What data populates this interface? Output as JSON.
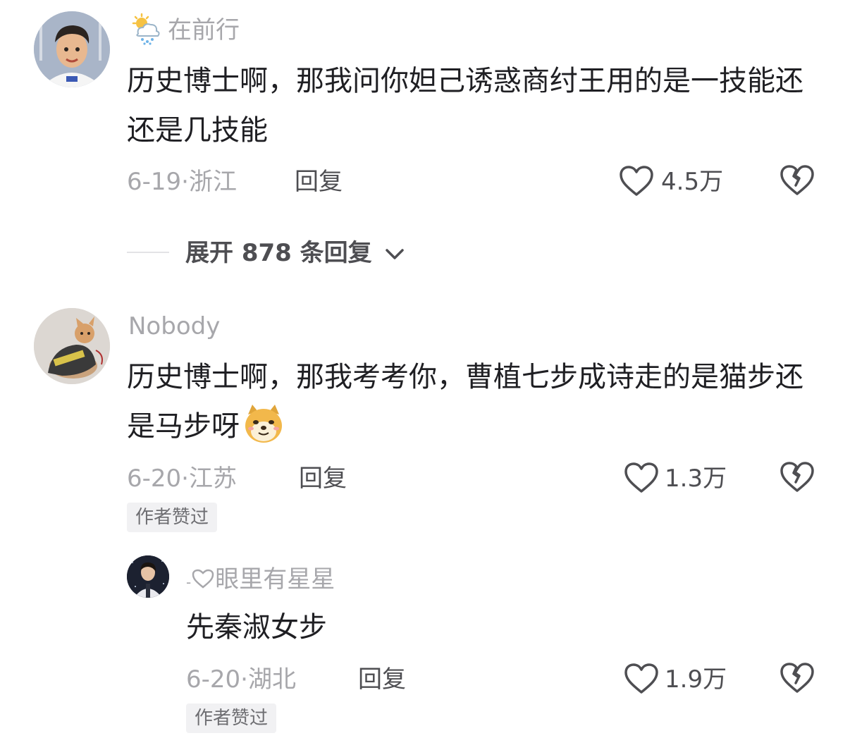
{
  "comments": [
    {
      "username": "在前行",
      "username_icon": "sun-cloud-rain-icon",
      "text": "历史博士啊，那我问你妲己诱惑商纣王用的是一技能还还是几技能",
      "date": "6-19",
      "location": "浙江",
      "reply_label": "回复",
      "likes": "4.5万"
    },
    {
      "username": "Nobody",
      "text": "历史博士啊，那我考考你，曹植七步成诗走的是猫步还是马步呀",
      "emoji": "doge-emoji",
      "date": "6-20",
      "location": "江苏",
      "reply_label": "回复",
      "likes": "1.3万",
      "badge": "作者赞过"
    }
  ],
  "expand": {
    "label": "展开 878 条回复"
  },
  "reply": {
    "username_prefix": "-",
    "username": "眼里有星星",
    "text": "先秦淑女步",
    "date": "6-20",
    "location": "湖北",
    "reply_label": "回复",
    "likes": "1.9万",
    "badge": "作者赞过"
  },
  "colors": {
    "text_primary": "#1f1f23",
    "text_secondary": "#a7a7ab",
    "text_action": "#4e4e52",
    "badge_bg": "#f1f1f3"
  }
}
